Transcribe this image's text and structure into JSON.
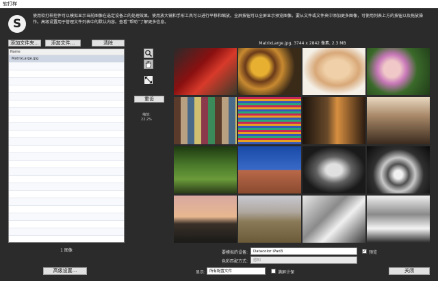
{
  "window": {
    "title": "软打样"
  },
  "header": {
    "logo_letter": "S",
    "description": "使用软打样控件可以模拟显示当前图像在选定设备上的处理效果。使用放大镜和手形工具可以进行平移和缩放。全屏按钮可以全屏显示预览图像。要从文件或文件夹中添加更多图像，可使用列表上方的按钮以及拖放操作。高级设置用于管理文件列表中的默认内容。查看“帮助”了解更多信息。"
  },
  "left_panel": {
    "add_folder_label": "添加文件夹...",
    "add_file_label": "添加文件...",
    "clear_label": "清除",
    "list_header": "Name",
    "files": [
      "MatrixLarge.jpg"
    ],
    "image_count": "1 图像",
    "advanced_label": "高级设置..."
  },
  "tools": {
    "zoom_icon": "magnifier-icon",
    "hand_icon": "hand-icon",
    "fullscreen_icon": "fullscreen-icon",
    "reset_label": "重设",
    "zoom_label": "缩放:",
    "zoom_value": "22.2%"
  },
  "preview": {
    "image_info": "MatrixLarge.jpg, 3744 x 2842 像素, 2.3 MB"
  },
  "bottom": {
    "device_label": "要模拟的设备:",
    "device_value": "Datacolor iPad3",
    "preview_label": "预览",
    "preview_checked": true,
    "render_label": "色彩匹配方式:",
    "render_value": "感知",
    "display_label": "显示:",
    "display_value": "所有配置文件",
    "fullscreen_label": "满屏计保",
    "fullscreen_checked": false,
    "close_label": "关闭"
  },
  "colors": {
    "background": "#2b2b2b",
    "button": "#e1e1e1",
    "list_selected": "#cfd6e4"
  }
}
